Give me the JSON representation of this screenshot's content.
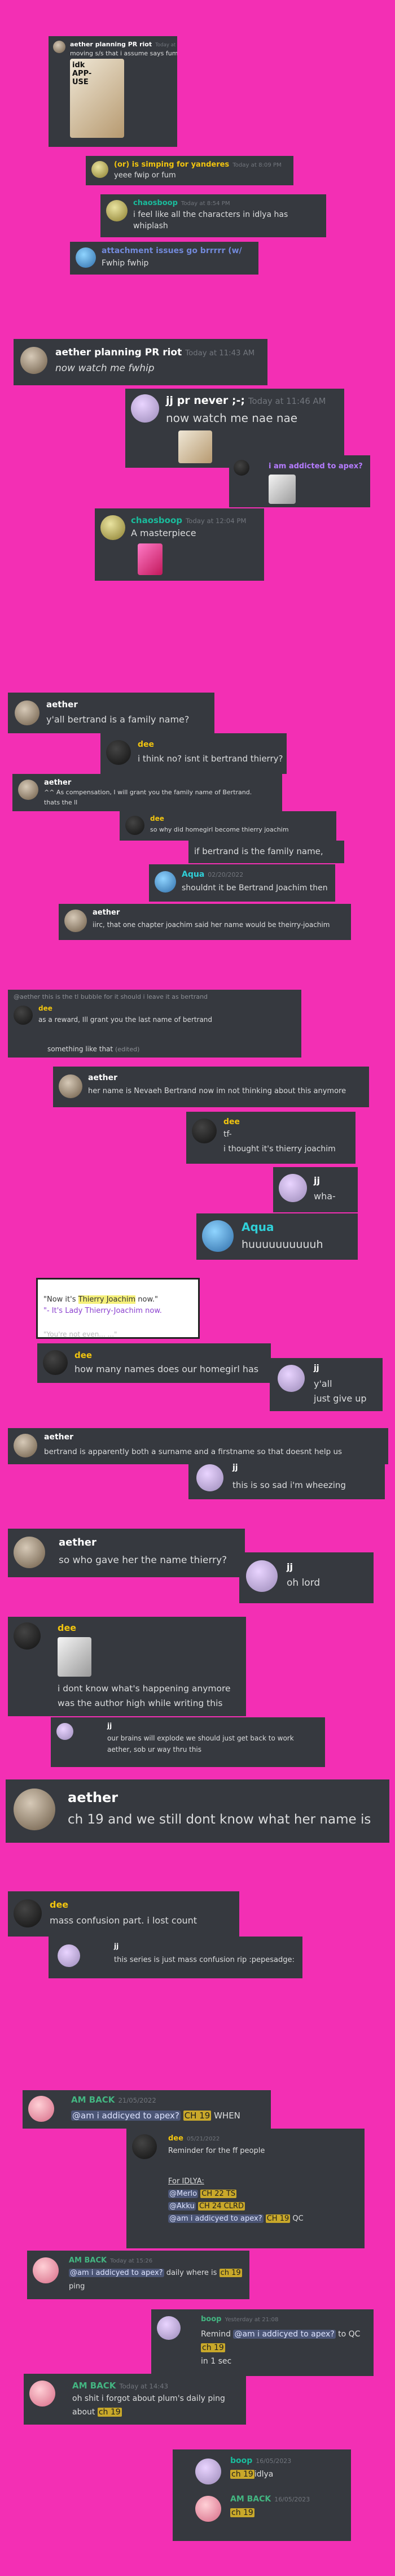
{
  "c1": {
    "n1": "aether planning PR riot",
    "t1": "Today at 8:09 PM",
    "m1": "moving s/s that i assume says fuml?",
    "meme": "idk APP-USE"
  },
  "c2": {
    "n": "(or) is simping for yanderes",
    "t": "Today at 8:09 PM",
    "m": "yeee fwip or fum"
  },
  "c3": {
    "n": "chaosboop",
    "t": "Today at 8:54 PM",
    "m1": "i feel like all the characters in idlya has",
    "m2": "whiplash"
  },
  "c4": {
    "n": "attachment issues go brrrrr (w/",
    "m": "Fwhip fwhip"
  },
  "c5": {
    "n": "aether planning PR riot",
    "t": "Today at 11:43 AM",
    "m": "now watch me fwhip"
  },
  "c6": {
    "n": "jj pr never ;-;",
    "t": "Today at 11:46 AM",
    "m": "now watch me nae nae"
  },
  "c6b": {
    "n": "i am addicted to apex?"
  },
  "c7": {
    "n": "chaosboop",
    "t": "Today at 12:04 PM",
    "m": "A masterpiece"
  },
  "c8": {
    "n": "aether",
    "m": "y'all bertrand is a family name?"
  },
  "c9": {
    "n": "dee",
    "m": "i think no? isnt it bertrand thierry?"
  },
  "c10": {
    "n": "aether",
    "m1": "^^ As compensation, I will grant you the family name of Bertrand.",
    "m2": "thats the ll"
  },
  "c11": {
    "n": "dee",
    "m": "so why did homegirl become thierry joachim"
  },
  "c11b": {
    "m": "if bertrand is the family name,"
  },
  "c12": {
    "n": "Aqua",
    "t": "02/20/2022",
    "m": "shouldnt it be Bertrand Joachim then"
  },
  "c13": {
    "n": "aether",
    "m": "iirc, that one chapter joachim said her name would be theirry-joachim"
  },
  "c14": {
    "r": "@aether this is the tl bubble for it  should i leave it as bertrand",
    "n": "dee",
    "m1": "as a reward, Ill grant you the last name of bertrand",
    "m2": "something like that",
    "e": "(edited)"
  },
  "c15": {
    "n": "aether",
    "m": "her name is Nevaeh Bertrand now im not thinking about this anymore"
  },
  "c16": {
    "n": "dee",
    "m1": "tf-",
    "m2": "i thought it's thierry joachim"
  },
  "c17": {
    "n": "jj",
    "m": "wha-"
  },
  "c18": {
    "n": "Aqua",
    "m": "huuuuuuuuuuh"
  },
  "c19": {
    "q1a": "\"Now it's ",
    "q1b": "Thierry Joachim",
    "q1c": " now.\"",
    "q2": "\"- It's Lady Thierry-Joachim now.",
    "q3": "\"You're not even... ...\""
  },
  "c20": {
    "n": "dee",
    "m": "how many names does our homegirl has"
  },
  "c21": {
    "n": "jj",
    "m1": "y'all",
    "m2": "just give up"
  },
  "c22": {
    "n": "aether",
    "m": "bertrand is apparently both a surname and a firstname so that doesnt help us"
  },
  "c23": {
    "n": "jj",
    "m": "this is so sad i'm wheezing"
  },
  "c24": {
    "n": "aether",
    "m": "so who gave her the name thierry?"
  },
  "c25": {
    "n": "jj",
    "m": "oh lord"
  },
  "c26": {
    "n": "dee",
    "m1": "i dont know what's happening anymore",
    "m2": "was the author high while writing this"
  },
  "c27": {
    "n": "jj",
    "m1": "our brains will explode we should just get back to work",
    "m2": "aether, sob ur way thru this"
  },
  "c28": {
    "n": "aether",
    "m": "ch 19 and we still dont know what her name is"
  },
  "c29": {
    "n": "dee",
    "m": "mass confusion part. i lost count"
  },
  "c30": {
    "n": "jj",
    "m": "this series is just mass confusion rip :pepesadge:"
  },
  "c31": {
    "n": "AM BACK",
    "t": "21/05/2022",
    "mention": "@am i addicyed to apex?",
    "ch": "CH 19",
    "m": "WHEN"
  },
  "c32": {
    "n": "dee",
    "t": "05/21/2022",
    "m1": "Reminder for the ff people",
    "h": "For IDLYA:",
    "l1a": "@Merlo",
    "l1b": "CH 22 TS",
    "l2a": "@Akku",
    "l2b": "CH 24 CLRD",
    "l3a": "@am i addicyed to apex?",
    "l3b": "CH 19",
    "l3c": "QC"
  },
  "c33": {
    "n": "AM BACK",
    "t": "Today at 15:26",
    "mention": "@am i addicyed to apex?",
    "m": "daily where is",
    "ch": "ch 19",
    "m2": "ping"
  },
  "c34": {
    "n": "boop",
    "t": "Yesterday at 21:08",
    "m1": "Remind",
    "mention": "@am i addicyed to apex?",
    "m2": "to QC",
    "ch": "ch 19",
    "m3": "in 1 sec"
  },
  "c35": {
    "n": "AM BACK",
    "t": "Today at 14:43",
    "m1": "oh shit i forgot about plum's daily ping",
    "m2": "about",
    "ch": "ch 19"
  },
  "c36": {
    "n1": "boop",
    "t1": "16/05/2023",
    "ch1": "ch 19",
    "m1": "idlya",
    "n2": "AM BACK",
    "t2": "16/05/2023",
    "ch2": "ch 19"
  }
}
